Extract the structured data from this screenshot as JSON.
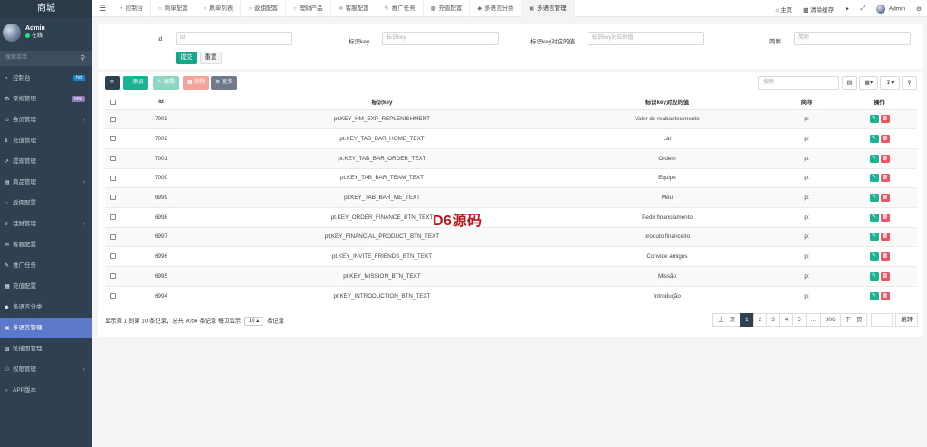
{
  "sidebar": {
    "brand": "商城",
    "user": {
      "name": "Admin",
      "status": "在线"
    },
    "search_placeholder": "搜索菜单",
    "items": [
      {
        "label": "控制台",
        "icon": "dashboard-icon",
        "badge": "hot"
      },
      {
        "label": "常规管理",
        "icon": "cogs-icon",
        "badge": "new"
      },
      {
        "label": "会员管理",
        "icon": "user-icon",
        "caret": true
      },
      {
        "label": "充值管理",
        "icon": "money-icon"
      },
      {
        "label": "提现管理",
        "icon": "withdraw-icon"
      },
      {
        "label": "商品管理",
        "icon": "shop-icon",
        "caret": true
      },
      {
        "label": "返佣配置",
        "icon": "circle-icon"
      },
      {
        "label": "理财管理",
        "icon": "finance-icon",
        "caret": true
      },
      {
        "label": "客服配置",
        "icon": "support-icon"
      },
      {
        "label": "推广任务",
        "icon": "task-icon"
      },
      {
        "label": "充值配置",
        "icon": "config-icon"
      },
      {
        "label": "多语言分类",
        "icon": "tag-icon"
      },
      {
        "label": "多语言管理",
        "icon": "language-icon",
        "active": true
      },
      {
        "label": "轮播图管理",
        "icon": "image-icon"
      },
      {
        "label": "权限管理",
        "icon": "group-icon",
        "caret": true
      },
      {
        "label": "APP版本",
        "icon": "circle-icon"
      }
    ]
  },
  "topbar": {
    "tabs": [
      {
        "label": "控制台",
        "icon": "dashboard-icon"
      },
      {
        "label": "刷单配置",
        "icon": "circle-icon"
      },
      {
        "label": "刷单列表",
        "icon": "circle-icon"
      },
      {
        "label": "返佣配置",
        "icon": "circle-icon"
      },
      {
        "label": "理财产品",
        "icon": "circle-icon"
      },
      {
        "label": "客服配置",
        "icon": "support-icon"
      },
      {
        "label": "推广任务",
        "icon": "task-icon"
      },
      {
        "label": "充值配置",
        "icon": "config-icon"
      },
      {
        "label": "多语言分类",
        "icon": "tag-icon"
      },
      {
        "label": "多语言管理",
        "icon": "language-icon",
        "active": true
      }
    ],
    "right": {
      "home": "主页",
      "clear_cache": "清除缓存",
      "user": "Admin"
    }
  },
  "filters": {
    "id_label": "Id",
    "id_placeholder": "Id",
    "key_label": "标识key",
    "key_placeholder": "标识key",
    "value_label": "标识key对应的值",
    "value_placeholder": "标识key对应的值",
    "short_label": "简称",
    "short_placeholder": "简称",
    "submit": "提交",
    "reset": "重置"
  },
  "toolbar": {
    "add": "添加",
    "edit": "编辑",
    "delete": "删除",
    "more": "更多",
    "search_placeholder": "搜索"
  },
  "table": {
    "headers": [
      "Id",
      "标识key",
      "标识key对应的值",
      "简称",
      "操作"
    ],
    "rows": [
      {
        "id": "7003",
        "key": "pt.KEY_HM_EXP_REPLENISHMENT",
        "value": "Valor de reabastecimento",
        "short": "pt"
      },
      {
        "id": "7002",
        "key": "pt.KEY_TAB_BAR_HOME_TEXT",
        "value": "Lar",
        "short": "pt"
      },
      {
        "id": "7001",
        "key": "pt.KEY_TAB_BAR_ORDER_TEXT",
        "value": "Ordem",
        "short": "pt"
      },
      {
        "id": "7000",
        "key": "pt.KEY_TAB_BAR_TEAM_TEXT",
        "value": "Equipe",
        "short": "pt"
      },
      {
        "id": "6999",
        "key": "pt.KEY_TAB_BAR_ME_TEXT",
        "value": "Meu",
        "short": "pt"
      },
      {
        "id": "6998",
        "key": "pt.KEY_ORDER_FINANCE_BTN_TEXT",
        "value": "Pedir financiamento",
        "short": "pt"
      },
      {
        "id": "6997",
        "key": "pt.KEY_FINANCIAL_PRODUCT_BTN_TEXT",
        "value": "produto financeiro",
        "short": "pt"
      },
      {
        "id": "6996",
        "key": "pt.KEY_INVITE_FRIENDS_BTN_TEXT",
        "value": "Convide amigos",
        "short": "pt"
      },
      {
        "id": "6995",
        "key": "pt.KEY_MISSION_BTN_TEXT",
        "value": "Missão",
        "short": "pt"
      },
      {
        "id": "6994",
        "key": "pt.KEY_INTRODUCTION_BTN_TEXT",
        "value": "Introdução",
        "short": "pt"
      }
    ]
  },
  "footer": {
    "summary_prefix": "显示第 1 到第 10 条记录，总共 3056 条记录 每页显示",
    "page_size": "10",
    "summary_suffix": "条记录"
  },
  "pagination": {
    "prev": "上一页",
    "pages": [
      "1",
      "2",
      "3",
      "4",
      "5",
      "...",
      "306"
    ],
    "current": "1",
    "next": "下一页",
    "goto": "跳转"
  },
  "watermark": "D6源码",
  "colors": {
    "sidebar_bg": "#2f4050",
    "active_menu": "#5c79c9",
    "primary": "#18a689",
    "danger": "#ed5565"
  }
}
